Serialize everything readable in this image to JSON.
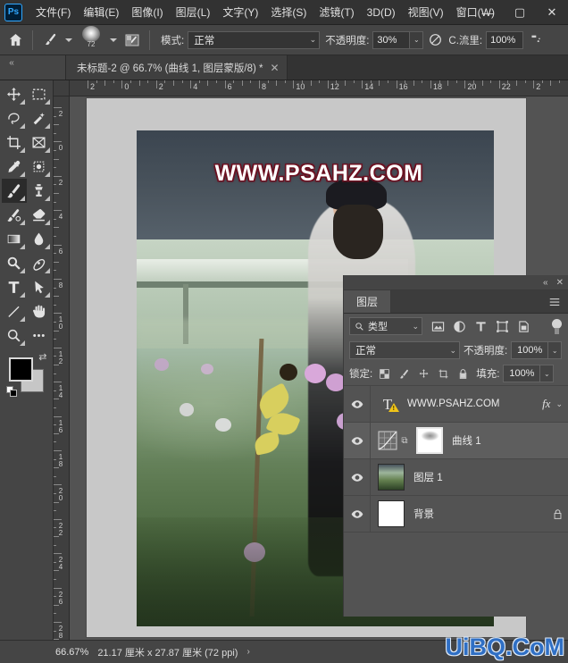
{
  "app": {
    "logo": "Ps",
    "menus": [
      {
        "label": "文件(F)",
        "name": "menu-file"
      },
      {
        "label": "编辑(E)",
        "name": "menu-edit"
      },
      {
        "label": "图像(I)",
        "name": "menu-image"
      },
      {
        "label": "图层(L)",
        "name": "menu-layer"
      },
      {
        "label": "文字(Y)",
        "name": "menu-type"
      },
      {
        "label": "选择(S)",
        "name": "menu-select"
      },
      {
        "label": "滤镜(T)",
        "name": "menu-filter"
      },
      {
        "label": "3D(D)",
        "name": "menu-3d"
      },
      {
        "label": "视图(V)",
        "name": "menu-view"
      },
      {
        "label": "窗口(W)",
        "name": "menu-window"
      }
    ],
    "window_controls": {
      "minimize": "—",
      "maximize": "▢",
      "close": "✕"
    }
  },
  "options_bar": {
    "home_icon": "home-icon",
    "brush_icon": "brush-icon",
    "brush_size": "72",
    "toggle_panel_icon": "brush-panel-icon",
    "mode_label": "模式:",
    "mode_value": "正常",
    "opacity_label": "不透明度:",
    "opacity_value": "30%",
    "pressure_opacity_icon": "pressure-opacity-icon",
    "flow_label": "C.流里:",
    "flow_value": "100%",
    "airbrush_icon": "airbrush-icon"
  },
  "tabbar": {
    "collapse_icon": "«",
    "document_title": "未标题-2 @ 66.7% (曲线 1, 图层蒙版/8) *",
    "close_icon": "✕"
  },
  "toolbar": {
    "tools": [
      {
        "name": "move-tool",
        "icon": "move-icon",
        "active": false
      },
      {
        "name": "marquee-tool",
        "icon": "rect-marquee-icon",
        "active": false
      },
      {
        "name": "lasso-tool",
        "icon": "lasso-icon",
        "active": false
      },
      {
        "name": "quick-select-tool",
        "icon": "magic-wand-icon",
        "active": false
      },
      {
        "name": "crop-tool",
        "icon": "crop-icon",
        "active": false
      },
      {
        "name": "frame-tool",
        "icon": "frame-icon",
        "active": false
      },
      {
        "name": "eyedropper-tool",
        "icon": "eyedropper-icon",
        "active": false
      },
      {
        "name": "spot-healing-tool",
        "icon": "healing-brush-icon",
        "active": false
      },
      {
        "name": "brush-tool",
        "icon": "brush-icon",
        "active": true
      },
      {
        "name": "clone-stamp-tool",
        "icon": "clone-stamp-icon",
        "active": false
      },
      {
        "name": "history-brush-tool",
        "icon": "history-brush-icon",
        "active": false
      },
      {
        "name": "eraser-tool",
        "icon": "eraser-icon",
        "active": false
      },
      {
        "name": "gradient-tool",
        "icon": "gradient-icon",
        "active": false
      },
      {
        "name": "blur-tool",
        "icon": "blur-drop-icon",
        "active": false
      },
      {
        "name": "dodge-tool",
        "icon": "dodge-icon",
        "active": false
      },
      {
        "name": "pen-tool",
        "icon": "pen-icon",
        "active": false
      },
      {
        "name": "type-tool",
        "icon": "type-T-icon",
        "active": false
      },
      {
        "name": "path-select-tool",
        "icon": "path-arrow-icon",
        "active": false
      },
      {
        "name": "line-tool",
        "icon": "line-icon",
        "active": false
      },
      {
        "name": "hand-tool",
        "icon": "hand-icon",
        "active": false
      },
      {
        "name": "zoom-tool",
        "icon": "zoom-magnifier-icon",
        "active": false
      },
      {
        "name": "more-tools",
        "icon": "ellipsis-icon",
        "active": false
      }
    ],
    "foreground_color": "#000000",
    "background_color": "#c6c6c6",
    "swap_icon": "swap-colors-icon",
    "default_icon": "default-colors-icon"
  },
  "rulers": {
    "horizontal_labels": [
      "2",
      "0",
      "2",
      "4",
      "6",
      "8",
      "10",
      "12",
      "14",
      "16",
      "18",
      "20",
      "22",
      "2"
    ],
    "vertical_labels": [
      "2",
      "0",
      "2",
      "4",
      "6",
      "8",
      "10",
      "12",
      "14",
      "16",
      "18",
      "20",
      "22",
      "24",
      "26",
      "28"
    ],
    "unit": "厘米"
  },
  "canvas": {
    "watermark_text": "WWW.PSAHZ.COM",
    "watermark_color": "#ffffff",
    "watermark_stroke": "#6b1020",
    "description": "photo-of-woman-in-flower-field-with-green-house"
  },
  "layers_panel": {
    "collapse_icon": "«",
    "close_icon": "✕",
    "title": "图层",
    "menu_icon": "hamburger-icon",
    "filter_label": "类型",
    "filter_icons": [
      "pixel-filter-icon",
      "adjustment-filter-icon",
      "type-filter-icon",
      "shape-filter-icon",
      "smart-object-filter-icon"
    ],
    "filter_toggle_icon": "filter-power-toggle",
    "blend_mode": "正常",
    "opacity_label": "不透明度:",
    "opacity_value": "100%",
    "lock_label": "锁定:",
    "lock_icons": [
      "lock-transparency-icon",
      "lock-image-icon",
      "lock-position-icon",
      "lock-artboard-icon",
      "lock-all-icon"
    ],
    "fill_label": "填充:",
    "fill_value": "100%",
    "layers": [
      {
        "name": "WWW.PSAHZ.COM",
        "type": "text",
        "visible": true,
        "selected": false,
        "has_fx": true,
        "fx_label": "fx",
        "fx_expand_icon": "chevron-down-icon",
        "warning": true,
        "locked": false
      },
      {
        "name": "曲线 1",
        "type": "adjustment-curves",
        "visible": true,
        "selected": true,
        "has_mask": true,
        "link_icon": "link-icon",
        "has_fx": false,
        "locked": false
      },
      {
        "name": "图层 1",
        "type": "pixel",
        "visible": true,
        "selected": false,
        "has_fx": false,
        "locked": false
      },
      {
        "name": "背景",
        "type": "background",
        "visible": true,
        "selected": false,
        "has_fx": false,
        "locked": true,
        "lock_icon": "padlock-icon"
      }
    ]
  },
  "statusbar": {
    "zoom": "66.67%",
    "dimensions": "21.17 厘米 x 27.87 厘米 (72 ppi)",
    "arrow_icon": "›"
  },
  "watermark": {
    "text": "UiBQ.CoM",
    "color": "#2f6fc4"
  }
}
